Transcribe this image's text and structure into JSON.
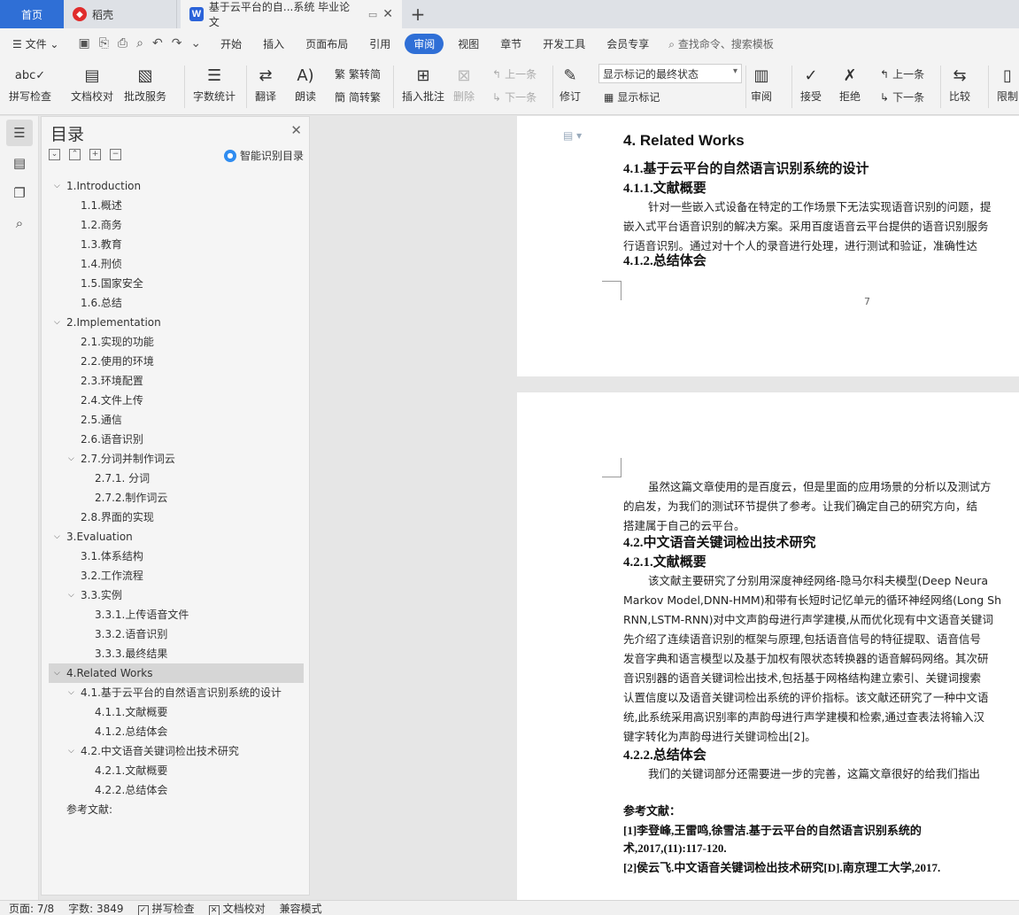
{
  "tabs": {
    "home": "首页",
    "daoke": "稻壳",
    "doc": "基于云平台的自...系统 毕业论文",
    "new_tab": "+"
  },
  "menu": {
    "file": "文件",
    "items": [
      "开始",
      "插入",
      "页面布局",
      "引用",
      "审阅",
      "视图",
      "章节",
      "开发工具",
      "会员专享"
    ],
    "active": "审阅",
    "search": "查找命令、搜索模板"
  },
  "ribbon": {
    "spell_check": "拼写检查",
    "doc_proof": "文档校对",
    "batch_service": "批改服务",
    "word_count": "字数统计",
    "translate": "翻译",
    "read_aloud": "朗读",
    "trad_to_simp": "繁转简",
    "simp_to_trad": "简转繁",
    "insert_comment": "插入批注",
    "delete": "删除",
    "prev_comment": "上一条",
    "next_comment": "下一条",
    "revise": "修订",
    "markup_select": "显示标记的最终状态",
    "show_markup": "显示标记",
    "review": "审阅",
    "accept": "接受",
    "reject": "拒绝",
    "prev_change": "上一条",
    "next_change": "下一条",
    "compare": "比较",
    "restrict": "限制"
  },
  "toc": {
    "title": "目录",
    "smart": "智能识别目录",
    "items": [
      {
        "label": "1.Introduction",
        "level": 1,
        "toggle": "v"
      },
      {
        "label": "1.1.概述",
        "level": 2
      },
      {
        "label": "1.2.商务",
        "level": 2
      },
      {
        "label": "1.3.教育",
        "level": 2
      },
      {
        "label": "1.4.刑侦",
        "level": 2
      },
      {
        "label": "1.5.国家安全",
        "level": 2
      },
      {
        "label": "1.6.总结",
        "level": 2
      },
      {
        "label": "2.Implementation",
        "level": 1,
        "toggle": "v"
      },
      {
        "label": "2.1.实现的功能",
        "level": 2
      },
      {
        "label": "2.2.使用的环境",
        "level": 2
      },
      {
        "label": "2.3.环境配置",
        "level": 2
      },
      {
        "label": "2.4.文件上传",
        "level": 2
      },
      {
        "label": "2.5.通信",
        "level": 2
      },
      {
        "label": "2.6.语音识别",
        "level": 2
      },
      {
        "label": "2.7.分词并制作词云",
        "level": 2,
        "toggle": "v"
      },
      {
        "label": "2.7.1. 分词",
        "level": 3
      },
      {
        "label": "2.7.2.制作词云",
        "level": 3
      },
      {
        "label": "2.8.界面的实现",
        "level": 2
      },
      {
        "label": "3.Evaluation",
        "level": 1,
        "toggle": "v"
      },
      {
        "label": "3.1.体系结构",
        "level": 2
      },
      {
        "label": "3.2.工作流程",
        "level": 2
      },
      {
        "label": "3.3.实例",
        "level": 2,
        "toggle": "v"
      },
      {
        "label": "3.3.1.上传语音文件",
        "level": 3
      },
      {
        "label": "3.3.2.语音识别",
        "level": 3
      },
      {
        "label": "3.3.3.最终结果",
        "level": 3
      },
      {
        "label": "4.Related Works",
        "level": 1,
        "toggle": "v",
        "selected": true
      },
      {
        "label": "4.1.基于云平台的自然语言识别系统的设计",
        "level": 2,
        "toggle": "v"
      },
      {
        "label": "4.1.1.文献概要",
        "level": 3
      },
      {
        "label": "4.1.2.总结体会",
        "level": 3
      },
      {
        "label": "4.2.中文语音关键词检出技术研究",
        "level": 2,
        "toggle": "v"
      },
      {
        "label": "4.2.1.文献概要",
        "level": 3
      },
      {
        "label": "4.2.2.总结体会",
        "level": 3
      },
      {
        "label": "参考文献:",
        "level": 1
      }
    ]
  },
  "document": {
    "page1": {
      "heading": "4. Related Works",
      "h41": "4.1.基于云平台的自然语言识别系统的设计",
      "h411": "4.1.1.文献概要",
      "p1": "针对一些嵌入式设备在特定的工作场景下无法实现语音识别的问题，提",
      "p2": "嵌入式平台语音识别的解决方案。采用百度语音云平台提供的语音识别服务",
      "p3": "行语音识别。通过对十个人的录音进行处理，进行测试和验证，准确性达",
      "h412": "4.1.2.总结体会",
      "page_number": "7"
    },
    "page2": {
      "p1": "虽然这篇文章使用的是百度云，但是里面的应用场景的分析以及测试方",
      "p2": "的启发，为我们的测试环节提供了参考。让我们确定自己的研究方向，结",
      "p3": "搭建属于自己的云平台。",
      "h42": "4.2.中文语音关键词检出技术研究",
      "h421": "4.2.1.文献概要",
      "q1": "该文献主要研究了分别用深度神经网络-隐马尔科夫模型(Deep Neura",
      "q2": "Markov Model,DNN-HMM)和带有长短时记忆单元的循环神经网络(Long Sh",
      "q3": "RNN,LSTM-RNN)对中文声韵母进行声学建模,从而优化现有中文语音关键词",
      "q4": "先介绍了连续语音识别的框架与原理,包括语音信号的特征提取、语音信号",
      "q5": "发音字典和语言模型以及基于加权有限状态转换器的语音解码网络。其次研",
      "q6": "音识别器的语音关键词检出技术,包括基于网格结构建立索引、关键词搜索",
      "q7": "认置信度以及语音关键词检出系统的评价指标。该文献还研究了一种中文语",
      "q8": "统,此系统采用高识别率的声韵母进行声学建模和检索,通过查表法将输入汉",
      "q9": "键字转化为声韵母进行关键词检出[2]。",
      "h422": "4.2.2.总结体会",
      "r1": "我们的关键词部分还需要进一步的完善，这篇文章很好的给我们指出",
      "refs_title": "参考文献：",
      "ref1a": "[1]李登峰,王雷鸣,徐雪洁.基于云平台的自然语言识别系统的",
      "ref1b": "术,2017,(11):117-120.",
      "ref2": "[2]侯云飞.中文语音关键词检出技术研究[D].南京理工大学,2017."
    }
  },
  "status": {
    "page": "页面: 7/8",
    "words": "字数: 3849",
    "spell": "拼写检查",
    "proof": "文档校对",
    "compat": "兼容模式"
  },
  "colors": {
    "accent": "#2f6fd6",
    "active_tab_text": "#ffffff"
  }
}
